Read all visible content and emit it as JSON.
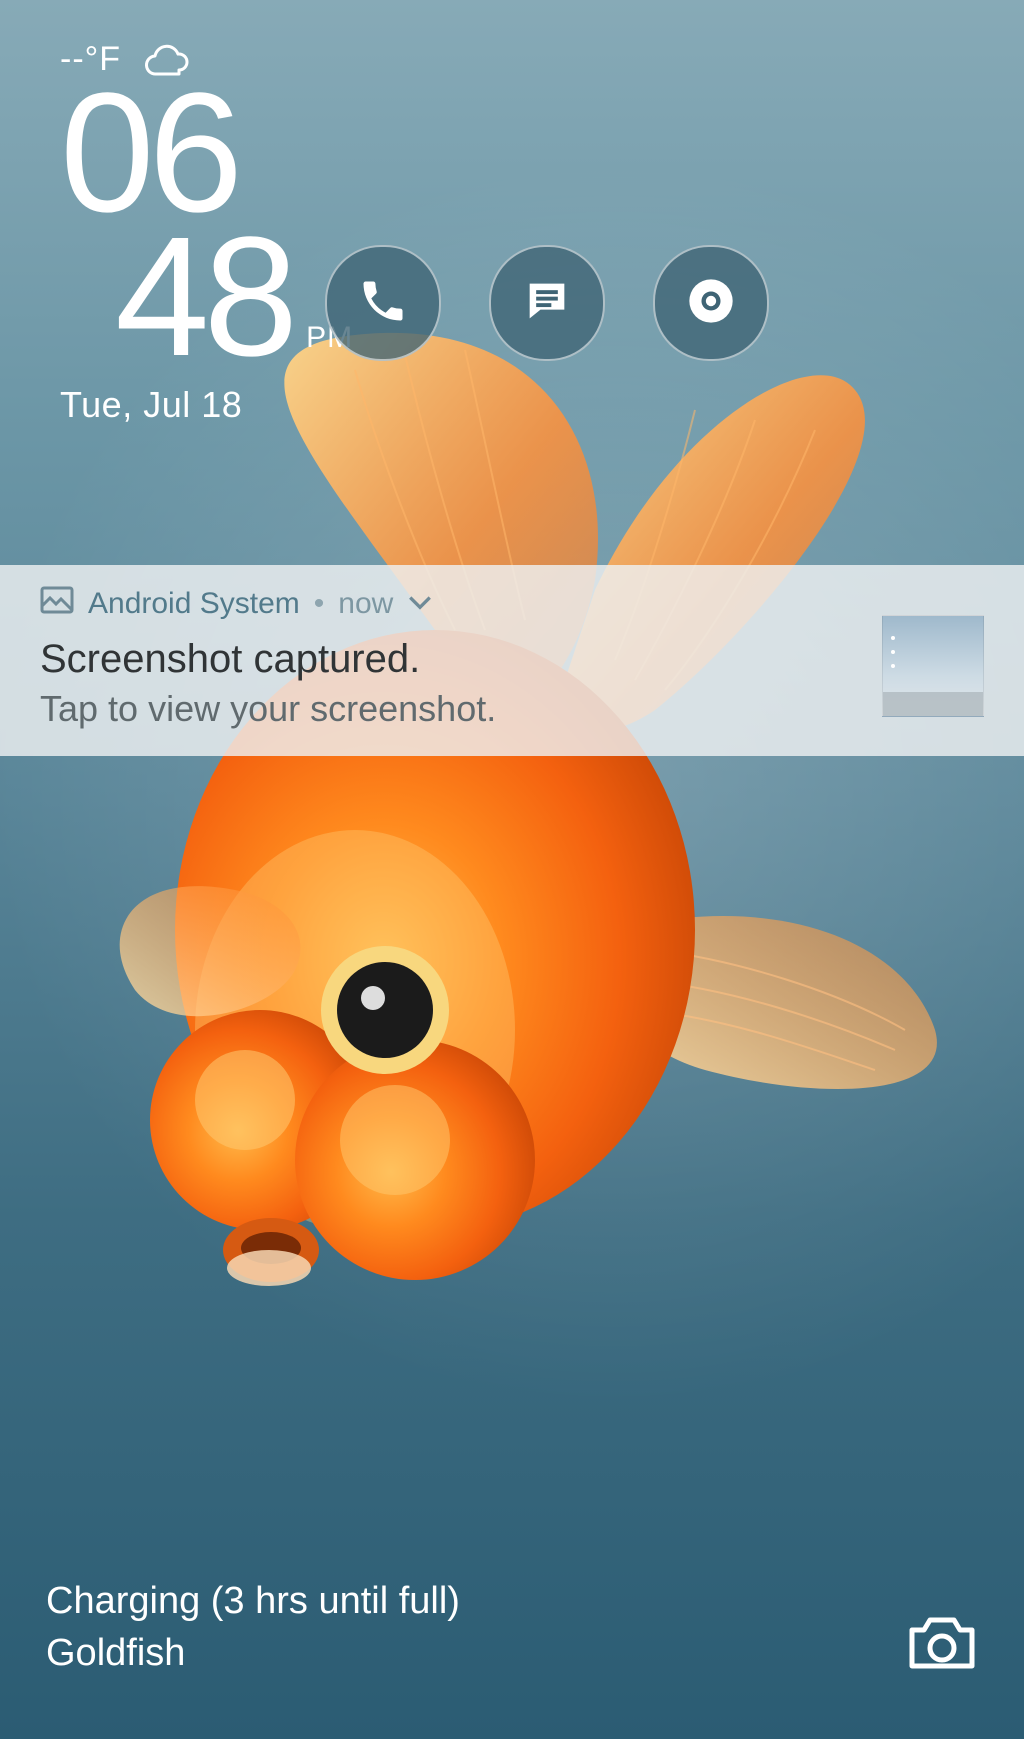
{
  "weather": {
    "temp_text": "--°F"
  },
  "clock": {
    "hours": "06",
    "minutes": "48",
    "ampm": "PM",
    "date": "Tue, Jul 18"
  },
  "shortcuts": {
    "phone": "phone-icon",
    "messages": "messages-icon",
    "chrome": "chrome-icon"
  },
  "notification": {
    "app": "Android System",
    "when": "now",
    "title": "Screenshot captured.",
    "subtitle": "Tap to view your screenshot."
  },
  "bottom": {
    "charging": "Charging (3 hrs until full)",
    "wallpaper_name": "Goldfish"
  }
}
